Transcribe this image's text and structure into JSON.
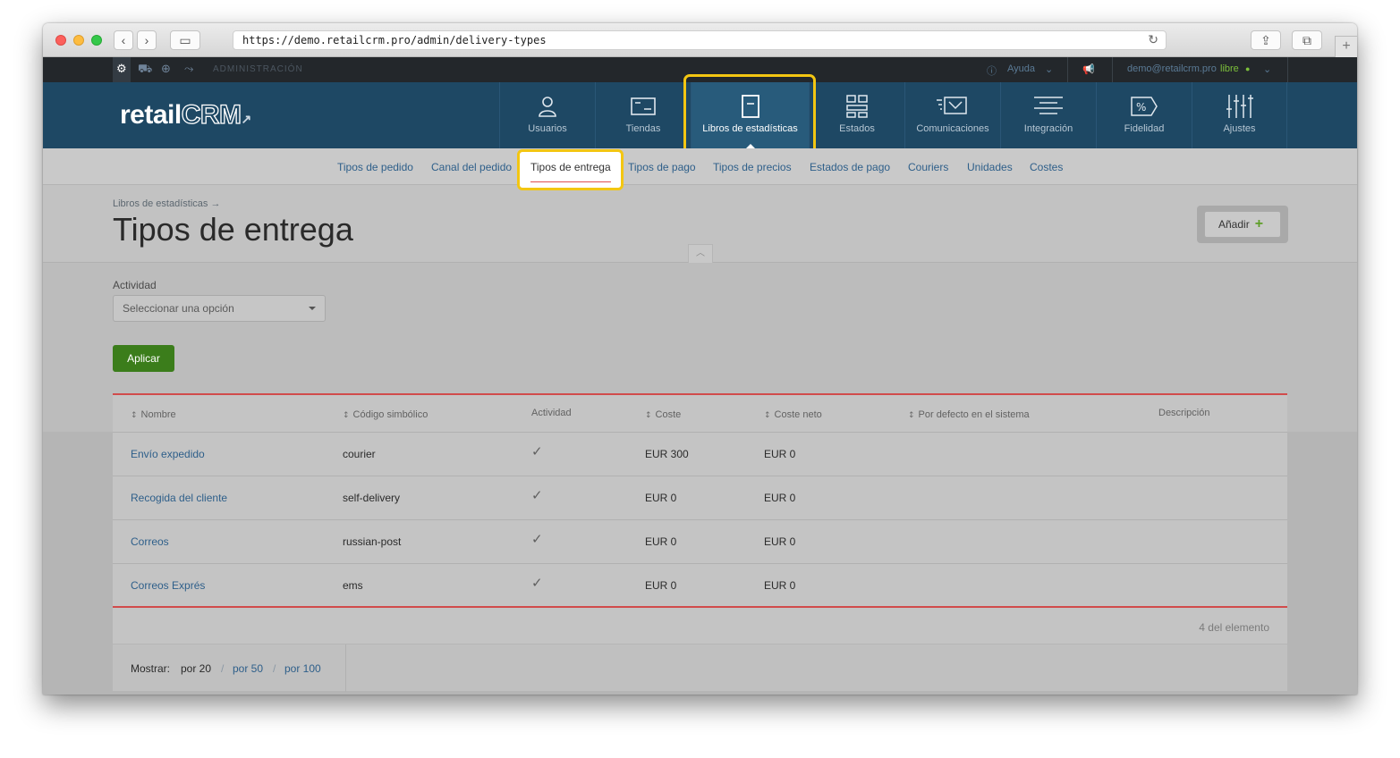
{
  "browser": {
    "url": "https://demo.retailcrm.pro/admin/delivery-types"
  },
  "topbar": {
    "section": "ADMINISTRACIÓN",
    "help": "Ayuda",
    "user": "demo@retailcrm.pro",
    "plan": "libre"
  },
  "logo": {
    "text1": "retail",
    "text2": "CRM"
  },
  "nav": [
    {
      "label": "Usuarios",
      "icon": "user-icon"
    },
    {
      "label": "Tiendas",
      "icon": "store-icon"
    },
    {
      "label": "Libros de estadísticas",
      "icon": "book-icon",
      "active": true
    },
    {
      "label": "Estados",
      "icon": "grid-icon"
    },
    {
      "label": "Comunicaciones",
      "icon": "mail-icon"
    },
    {
      "label": "Integración",
      "icon": "lines-icon"
    },
    {
      "label": "Fidelidad",
      "icon": "percent-tag-icon"
    },
    {
      "label": "Ajustes",
      "icon": "sliders-icon"
    }
  ],
  "subnav": [
    "Tipos de pedido",
    "Canal del pedido",
    "Tipos de entrega",
    "Tipos de pago",
    "Tipos de precios",
    "Estados de pago",
    "Couriers",
    "Unidades",
    "Costes"
  ],
  "breadcrumb": "Libros de estadísticas →",
  "page_title": "Tipos de entrega",
  "add_button": "Añadir",
  "filter": {
    "label": "Actividad",
    "placeholder": "Seleccionar una opción",
    "apply": "Aplicar"
  },
  "table": {
    "headers": [
      "Nombre",
      "Código simbólico",
      "Actividad",
      "Coste",
      "Coste neto",
      "Por defecto en el sistema",
      "Descripción"
    ],
    "rows": [
      {
        "name": "Envío expedido",
        "code": "courier",
        "active": true,
        "cost": "EUR 300",
        "net": "EUR 0"
      },
      {
        "name": "Recogida del cliente",
        "code": "self-delivery",
        "active": true,
        "cost": "EUR 0",
        "net": "EUR 0"
      },
      {
        "name": "Correos",
        "code": "russian-post",
        "active": true,
        "cost": "EUR 0",
        "net": "EUR 0"
      },
      {
        "name": "Correos Exprés",
        "code": "ems",
        "active": true,
        "cost": "EUR 0",
        "net": "EUR 0"
      }
    ],
    "count": "4 del elemento"
  },
  "pagination": {
    "label": "Mostrar:",
    "options": [
      "por 20",
      "por 50",
      "por 100"
    ]
  },
  "colors": {
    "nav_bg": "#1e4864",
    "highlight": "#f3c612",
    "apply": "#3b7d1b",
    "accent_red": "#d14b4b"
  }
}
